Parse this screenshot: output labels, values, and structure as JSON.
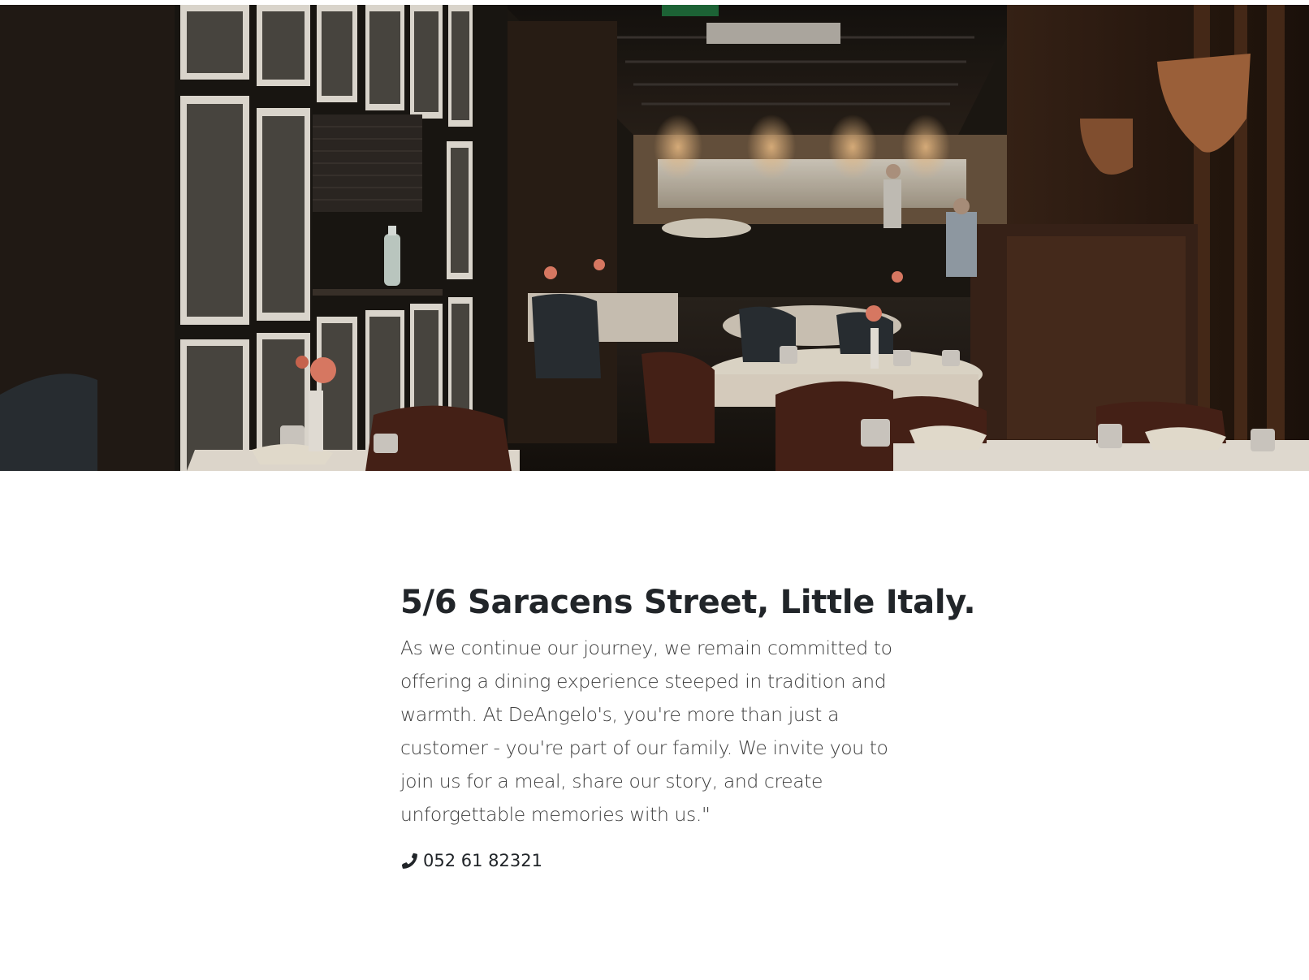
{
  "hero": {
    "image_subject": "restaurant-dining-room-photo"
  },
  "location": {
    "address": "5/6 Saracens Street, Little Italy.",
    "story": "As we continue our journey, we remain committed to offering a dining experience steeped in tradition and warmth. At DeAngelo's, you're more than just a customer - you're part of our family. We invite you to join us for a meal, share our story, and create unforgettable memories with us.\"",
    "phone_icon": "phone-icon",
    "phone": "052 61 82321"
  },
  "colors": {
    "heading": "#212529",
    "body_text": "#3d3d3d",
    "background": "#ffffff"
  }
}
